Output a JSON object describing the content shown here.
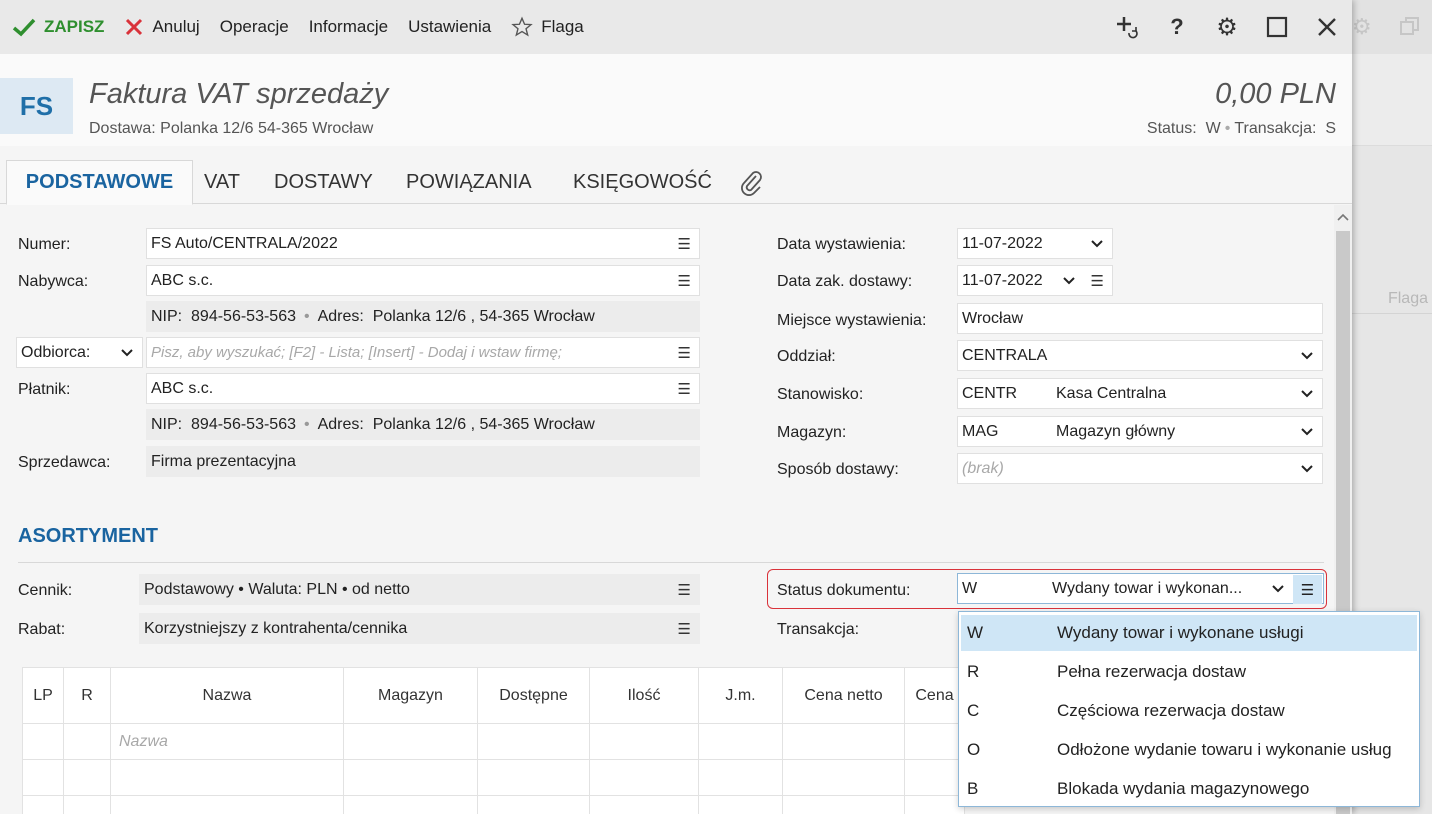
{
  "toolbar": {
    "save_label": "ZAPISZ",
    "cancel_label": "Anuluj",
    "operations_label": "Operacje",
    "info_label": "Informacje",
    "settings_label": "Ustawienia",
    "flag_label": "Flaga",
    "help_label": "?"
  },
  "background_window": {
    "flag_label": "Flaga"
  },
  "header": {
    "badge": "FS",
    "title": "Faktura VAT sprzedaży",
    "subtitle": "Dostawa: Polanka  12/6  54-365 Wrocław",
    "amount": "0,00 PLN",
    "status_label": "Status:",
    "status_value": "W",
    "transaction_label": "Transakcja:",
    "transaction_value": "S",
    "separator": "•"
  },
  "tabs": [
    {
      "label": "PODSTAWOWE",
      "active": true
    },
    {
      "label": "VAT"
    },
    {
      "label": "DOSTAWY"
    },
    {
      "label": "POWIĄZANIA"
    },
    {
      "label": "KSIĘGOWOŚĆ"
    }
  ],
  "form": {
    "numer": {
      "label": "Numer:",
      "value": "FS Auto/CENTRALA/2022"
    },
    "nabywca": {
      "label": "Nabywca:",
      "value": "ABC s.c.",
      "nip_label": "NIP:",
      "nip": "894-56-53-563",
      "address_label": "Adres:",
      "address": "Polanka  12/6 , 54-365 Wrocław"
    },
    "odbiorca": {
      "label": "Odbiorca:",
      "placeholder": "Pisz, aby wyszukać; [F2] - Lista; [Insert] - Dodaj i wstaw firmę;"
    },
    "platnik": {
      "label": "Płatnik:",
      "value": "ABC s.c.",
      "nip_label": "NIP:",
      "nip": "894-56-53-563",
      "address_label": "Adres:",
      "address": "Polanka  12/6 , 54-365 Wrocław"
    },
    "sprzedawca": {
      "label": "Sprzedawca:",
      "value": "Firma prezentacyjna"
    },
    "data_wystawienia": {
      "label": "Data wystawienia:",
      "value": "11-07-2022"
    },
    "data_dostawy": {
      "label": "Data zak. dostawy:",
      "value": "11-07-2022"
    },
    "miejsce": {
      "label": "Miejsce wystawienia:",
      "value": "Wrocław"
    },
    "oddzial": {
      "label": "Oddział:",
      "value": "CENTRALA"
    },
    "stanowisko": {
      "label": "Stanowisko:",
      "code": "CENTR",
      "value": "Kasa Centralna"
    },
    "magazyn": {
      "label": "Magazyn:",
      "code": "MAG",
      "value": "Magazyn główny"
    },
    "sposob_dostawy": {
      "label": "Sposób dostawy:",
      "placeholder": "(brak)"
    }
  },
  "asortyment": {
    "title": "ASORTYMENT",
    "cennik": {
      "label": "Cennik:",
      "value": "Podstawowy • Waluta: PLN • od netto"
    },
    "rabat": {
      "label": "Rabat:",
      "value": "Korzystniejszy z kontrahenta/cennika"
    },
    "status": {
      "label": "Status dokumentu:",
      "code": "W",
      "value": "Wydany towar i wykonan..."
    },
    "transakcja": {
      "label": "Transakcja:"
    }
  },
  "grid": {
    "columns": [
      "LP",
      "R",
      "Nazwa",
      "Magazyn",
      "Dostępne",
      "Ilość",
      "J.m.",
      "Cena netto",
      "Cena"
    ],
    "name_placeholder": "Nazwa"
  },
  "status_dropdown": {
    "options": [
      {
        "code": "W",
        "label": "Wydany towar i wykonane usługi",
        "selected": true
      },
      {
        "code": "R",
        "label": "Pełna rezerwacja dostaw"
      },
      {
        "code": "C",
        "label": "Częściowa rezerwacja dostaw"
      },
      {
        "code": "O",
        "label": "Odłożone wydanie towaru i wykonanie usług"
      },
      {
        "code": "B",
        "label": "Blokada wydania magazynowego"
      }
    ]
  },
  "colors": {
    "accent": "#1a64a0",
    "save_green": "#2f8f2f",
    "cancel_red": "#d9323a",
    "highlight_red": "#d9323a",
    "selection_blue": "#cfe6f6"
  },
  "icons": [
    "check-icon",
    "close-icon",
    "star-icon",
    "add-link-icon",
    "help-icon",
    "gear-icon",
    "maximize-icon",
    "close-window-icon",
    "paperclip-icon",
    "hamburger-icon",
    "chevron-down-icon"
  ]
}
